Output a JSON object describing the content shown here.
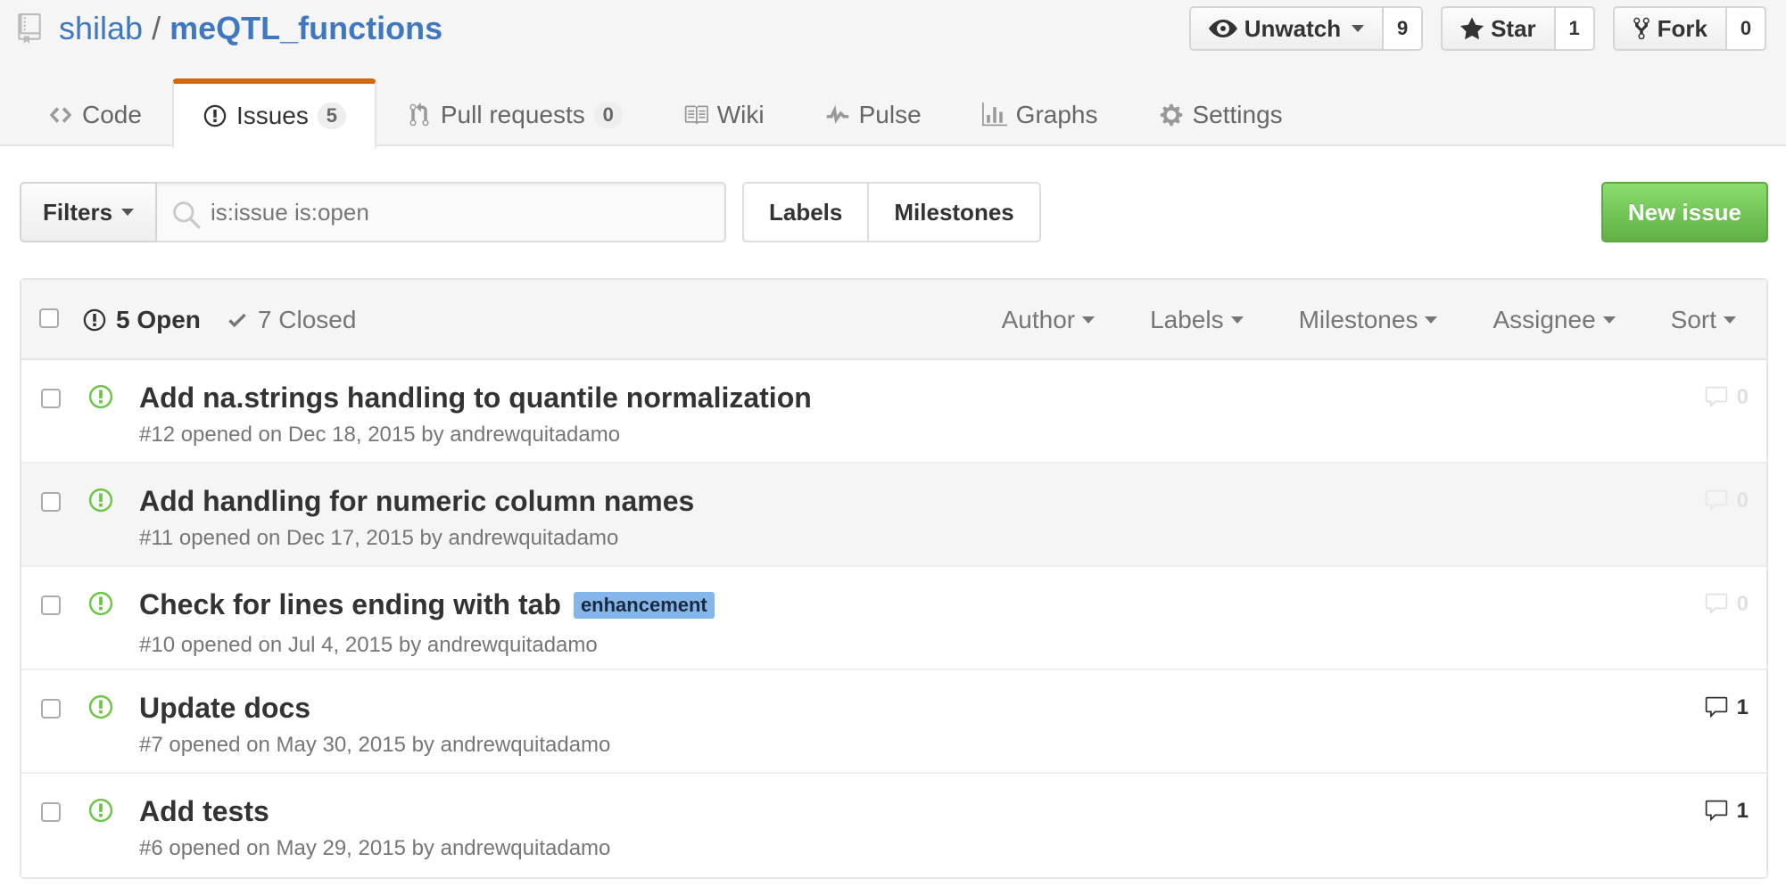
{
  "repo": {
    "owner": "shilab",
    "separator": "/",
    "name": "meQTL_functions"
  },
  "actions": {
    "watch": {
      "label": "Unwatch",
      "count": "9"
    },
    "star": {
      "label": "Star",
      "count": "1"
    },
    "fork": {
      "label": "Fork",
      "count": "0"
    }
  },
  "nav": {
    "code": "Code",
    "issues": {
      "label": "Issues",
      "count": "5"
    },
    "pulls": {
      "label": "Pull requests",
      "count": "0"
    },
    "wiki": "Wiki",
    "pulse": "Pulse",
    "graphs": "Graphs",
    "settings": "Settings"
  },
  "toolbar": {
    "filters_label": "Filters",
    "search_value": "is:issue is:open",
    "labels_label": "Labels",
    "milestones_label": "Milestones",
    "new_issue_label": "New issue"
  },
  "table_header": {
    "open": "5 Open",
    "closed": "7 Closed",
    "author": "Author",
    "labels": "Labels",
    "milestones": "Milestones",
    "assignee": "Assignee",
    "sort": "Sort"
  },
  "issues": [
    {
      "title": "Add na.strings handling to quantile normalization",
      "meta": "#12 opened on Dec 18, 2015 by andrewquitadamo",
      "comments": "0"
    },
    {
      "title": "Add handling for numeric column names",
      "meta": "#11 opened on Dec 17, 2015 by andrewquitadamo",
      "comments": "0"
    },
    {
      "title": "Check for lines ending with tab",
      "label": "enhancement",
      "meta": "#10 opened on Jul 4, 2015 by andrewquitadamo",
      "comments": "0"
    },
    {
      "title": "Update docs",
      "meta": "#7 opened on May 30, 2015 by andrewquitadamo",
      "comments": "1"
    },
    {
      "title": "Add tests",
      "meta": "#6 opened on May 29, 2015 by andrewquitadamo",
      "comments": "1"
    }
  ],
  "colors": {
    "link": "#4078c0",
    "tab_accent": "#d26911",
    "open_icon": "#6cc644",
    "new_issue_button": "#60b044",
    "enhancement_label": "#84b6eb"
  },
  "icons": {
    "repo": "repo-icon",
    "watch": "eye-icon",
    "star": "star-icon",
    "fork": "fork-icon",
    "code": "code-icon",
    "issues": "issue-opened-icon",
    "pulls": "git-pull-request-icon",
    "wiki": "book-icon",
    "pulse": "pulse-icon",
    "graphs": "graph-icon",
    "settings": "gear-icon",
    "search": "search-icon",
    "closed": "check-icon",
    "comment": "comment-icon"
  }
}
